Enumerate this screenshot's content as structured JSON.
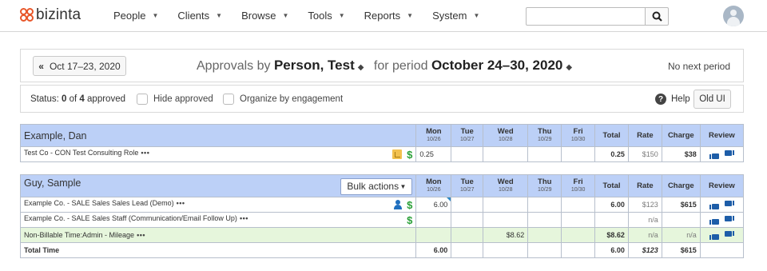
{
  "brand": {
    "logo_text": "bizinta",
    "accent": "#e8572a"
  },
  "nav": {
    "items": [
      {
        "label": "People"
      },
      {
        "label": "Clients"
      },
      {
        "label": "Browse"
      },
      {
        "label": "Tools"
      },
      {
        "label": "Reports"
      },
      {
        "label": "System"
      }
    ],
    "search": {
      "value": "",
      "placeholder": ""
    }
  },
  "period_bar": {
    "prev_label": "Oct 17–23, 2020",
    "title_prefix": "Approvals by",
    "person": "Person, Test",
    "for_period": "for period",
    "period": "October 24–30, 2020",
    "no_next": "No next period"
  },
  "status_bar": {
    "status_label": "Status:",
    "approved_count": "0",
    "of": "of",
    "total_count": "4",
    "approved_word": "approved",
    "hide_approved": "Hide approved",
    "organize": "Organize by engagement",
    "help": "Help",
    "old_ui": "Old UI"
  },
  "columns": {
    "days": [
      {
        "day": "Mon",
        "date": "10/26"
      },
      {
        "day": "Tue",
        "date": "10/27"
      },
      {
        "day": "Wed",
        "date": "10/28"
      },
      {
        "day": "Thu",
        "date": "10/29"
      },
      {
        "day": "Fri",
        "date": "10/30"
      }
    ],
    "total": "Total",
    "rate": "Rate",
    "charge": "Charge",
    "review": "Review"
  },
  "groups": [
    {
      "name": "Example, Dan",
      "rows": [
        {
          "label": "Test Co - CON Test Consulting Role",
          "mon": "0.25",
          "total": "0.25",
          "rate": "$150",
          "charge": "$38"
        }
      ]
    },
    {
      "name": "Guy, Sample",
      "bulk_label": "Bulk actions",
      "rows": [
        {
          "label": "Example Co. - SALE Sales Sales Lead (Demo)",
          "mon": "6.00",
          "total": "6.00",
          "rate": "$123",
          "charge": "$615"
        },
        {
          "label": "Example Co. - SALE Sales Staff (Communication/Email Follow Up)",
          "rate": "n/a"
        },
        {
          "label": "Non-Billable Time:Admin - Mileage",
          "wed": "$8.62",
          "total": "$8.62",
          "rate": "n/a",
          "charge": "n/a"
        }
      ],
      "total_row": {
        "label": "Total Time",
        "mon": "6.00",
        "total": "6.00",
        "rate": "$123",
        "charge": "$615"
      }
    }
  ],
  "dots": "•••"
}
